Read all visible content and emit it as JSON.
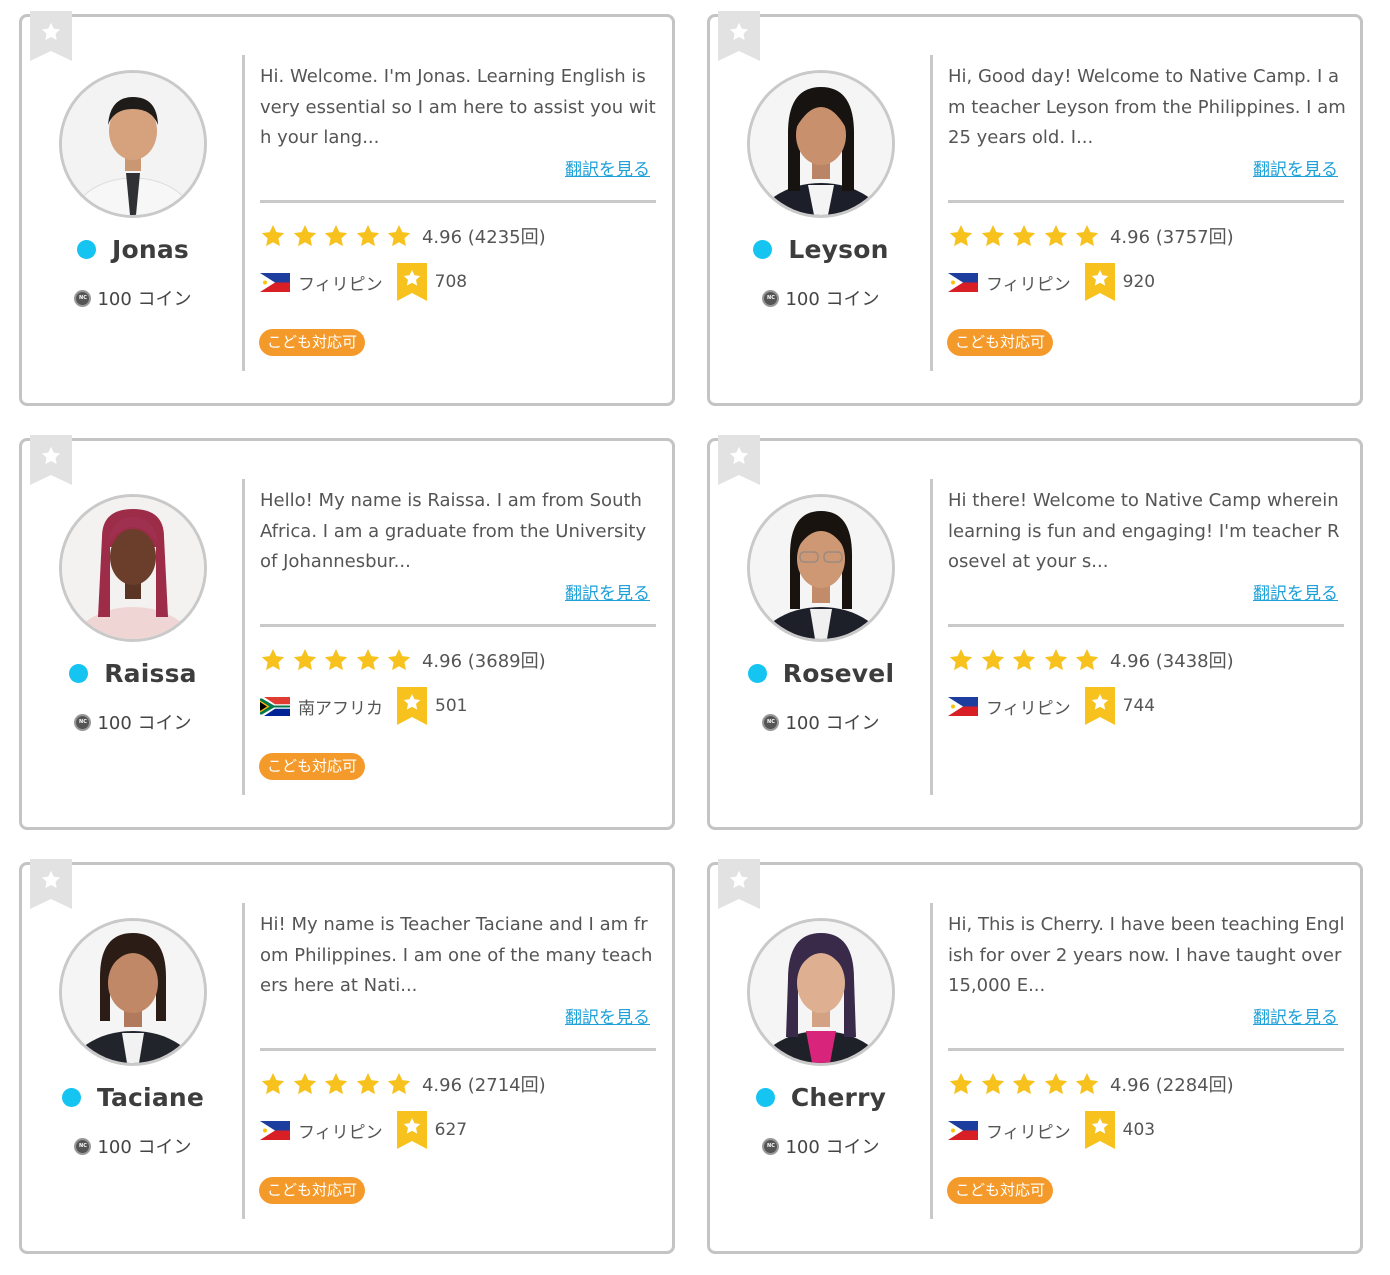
{
  "translate_label": "翻訳を見る",
  "kids_label": "こども対応可",
  "coin_icon_text": "NC",
  "colors": {
    "status_online": "#16c4f2",
    "star": "#f8c21e",
    "kids_badge": "#f49a2b",
    "link": "#1da1d8",
    "border": "#c4c4c4"
  },
  "teachers": [
    {
      "name": "Jonas",
      "coins": "100 コイン",
      "intro": "Hi. Welcome. I'm Jonas. Learning English is very essential so I am here to assist you with your lang...",
      "rating": "4.96 (4235回)",
      "stars": 5,
      "country": "フィリピン",
      "flag": "philippines-flag",
      "medal_count": "708"
    },
    {
      "name": "Leyson",
      "coins": "100 コイン",
      "intro": "Hi, Good day! Welcome to Native Camp. I am teacher Leyson from the Philippines. I am 25 years old. I...",
      "rating": "4.96 (3757回)",
      "stars": 5,
      "country": "フィリピン",
      "flag": "philippines-flag",
      "medal_count": "920"
    },
    {
      "name": "Raissa",
      "coins": "100 コイン",
      "intro": "Hello! My name is Raissa. I am from South Africa. I am a graduate from the University of Johannesbur...",
      "rating": "4.96 (3689回)",
      "stars": 5,
      "country": "南アフリカ",
      "flag": "south-africa-flag",
      "medal_count": "501"
    },
    {
      "name": "Rosevel",
      "coins": "100 コイン",
      "intro": "Hi there! Welcome to Native Camp wherein learning is fun and engaging! I'm teacher Rosevel at your s...",
      "rating": "4.96 (3438回)",
      "stars": 5,
      "country": "フィリピン",
      "flag": "philippines-flag",
      "medal_count": "744"
    },
    {
      "name": "Taciane",
      "coins": "100 コイン",
      "intro": "Hi! My name is Teacher Taciane and I am from Philippines. I am one of the many teachers here at Nati...",
      "rating": "4.96 (2714回)",
      "stars": 5,
      "country": "フィリピン",
      "flag": "philippines-flag",
      "medal_count": "627"
    },
    {
      "name": "Cherry",
      "coins": "100 コイン",
      "intro": "Hi, This is Cherry. I have been teaching English for over 2 years now. I have taught over 15,000 E...",
      "rating": "4.96 (2284回)",
      "stars": 5,
      "country": "フィリピン",
      "flag": "philippines-flag",
      "medal_count": "403"
    }
  ]
}
